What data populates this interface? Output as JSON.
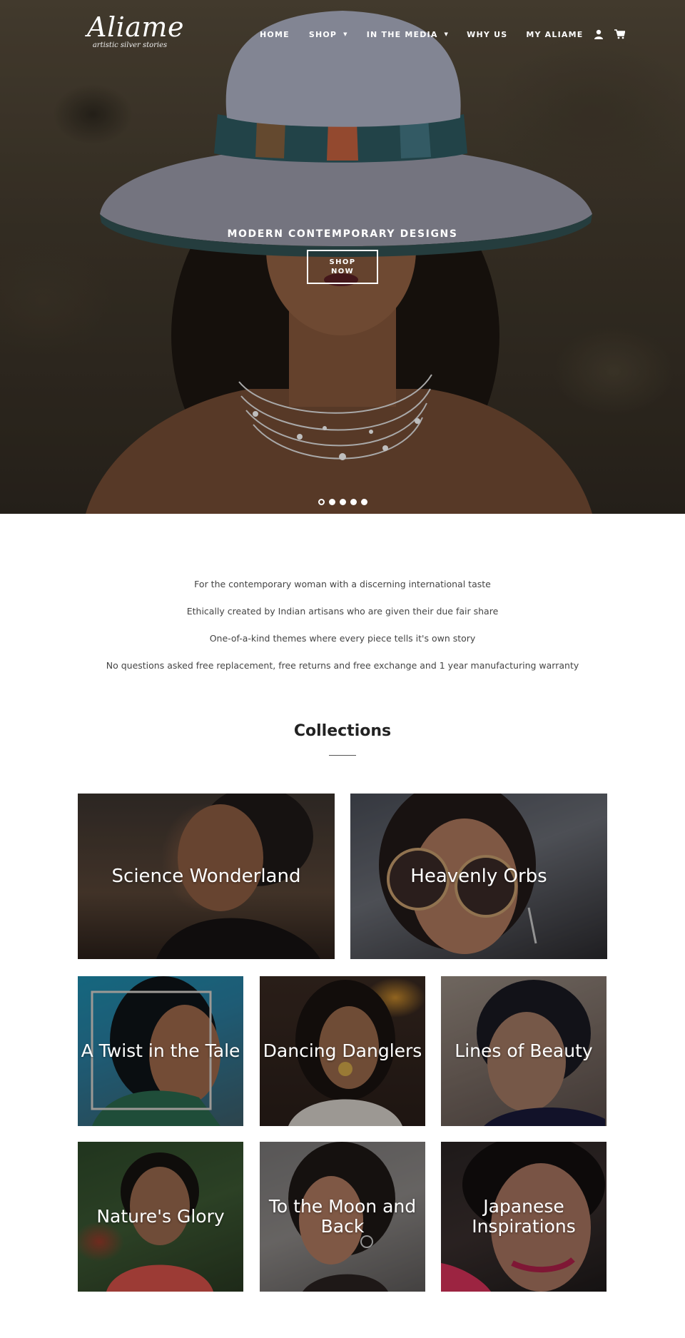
{
  "brand": {
    "name": "Aliame",
    "tagline": "artistic silver stories"
  },
  "nav": {
    "items": [
      {
        "label": "HOME"
      },
      {
        "label": "SHOP",
        "dropdown": true
      },
      {
        "label": "IN THE MEDIA",
        "dropdown": true
      },
      {
        "label": "WHY US"
      },
      {
        "label": "MY ALIAME"
      }
    ],
    "icons": [
      "account-icon",
      "cart-icon"
    ]
  },
  "hero": {
    "heading": "MODERN CONTEMPORARY DESIGNS",
    "button_label": "SHOP NOW",
    "slide_count": 5,
    "active_slide": 1
  },
  "intro": {
    "lines": [
      "For the contemporary woman with a discerning international taste",
      "Ethically created by Indian artisans who are given their due fair share",
      "One-of-a-kind themes where every piece tells it's own story",
      "No questions asked free replacement, free returns and free exchange and 1 year manufacturing warranty"
    ]
  },
  "collections": {
    "title": "Collections",
    "items": [
      {
        "label": "Science Wonderland"
      },
      {
        "label": "Heavenly Orbs"
      },
      {
        "label": "A Twist in the Tale"
      },
      {
        "label": "Dancing Danglers"
      },
      {
        "label": "Lines of Beauty"
      },
      {
        "label": "Nature's Glory"
      },
      {
        "label": "To the Moon and Back"
      },
      {
        "label": "Japanese Inspirations"
      }
    ]
  }
}
